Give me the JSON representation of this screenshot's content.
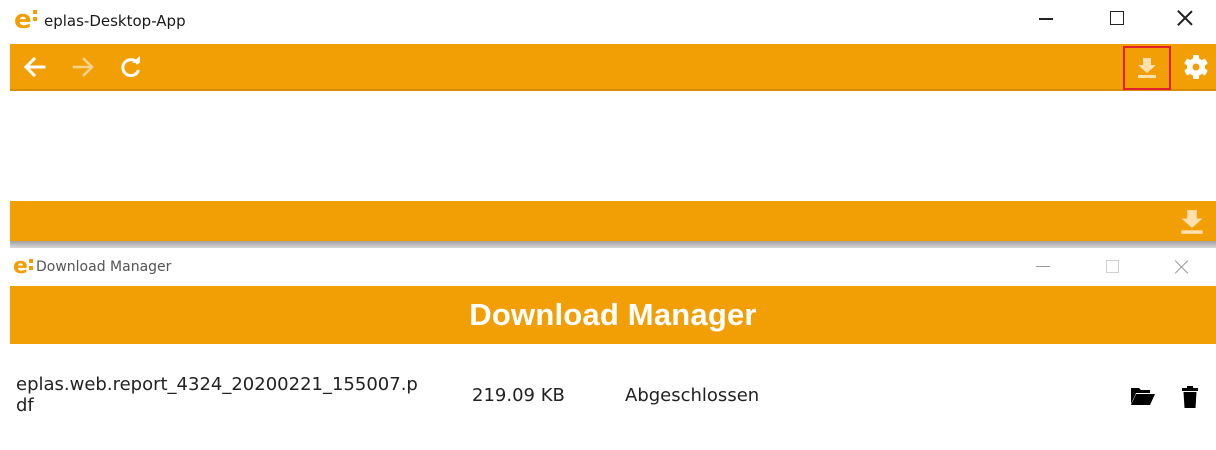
{
  "app": {
    "logo_text": "e",
    "title": "eplas-Desktop-App"
  },
  "window_controls": {
    "minimize": "minimize",
    "maximize": "maximize",
    "close": "close"
  },
  "toolbar": {
    "color": "#f29f05",
    "buttons": [
      {
        "name": "back",
        "icon": "arrow-left-icon",
        "enabled": true
      },
      {
        "name": "forward",
        "icon": "arrow-right-icon",
        "enabled": false
      },
      {
        "name": "reload",
        "icon": "reload-icon",
        "enabled": true
      },
      {
        "name": "downloads",
        "icon": "download-icon",
        "highlighted": true,
        "highlight_color": "#e0202e"
      },
      {
        "name": "settings",
        "icon": "gear-icon",
        "enabled": true
      }
    ]
  },
  "strip": {
    "icon": "download-icon"
  },
  "download_manager": {
    "window_title": "Download Manager",
    "header": "Download Manager",
    "downloads": [
      {
        "filename_line1": "eplas.web.report_4324_20200221_155007.p",
        "filename_line2": "df",
        "size": "219.09 KB",
        "status": "Abgeschlossen",
        "actions": [
          "folder-open-icon",
          "trash-icon"
        ]
      }
    ]
  }
}
